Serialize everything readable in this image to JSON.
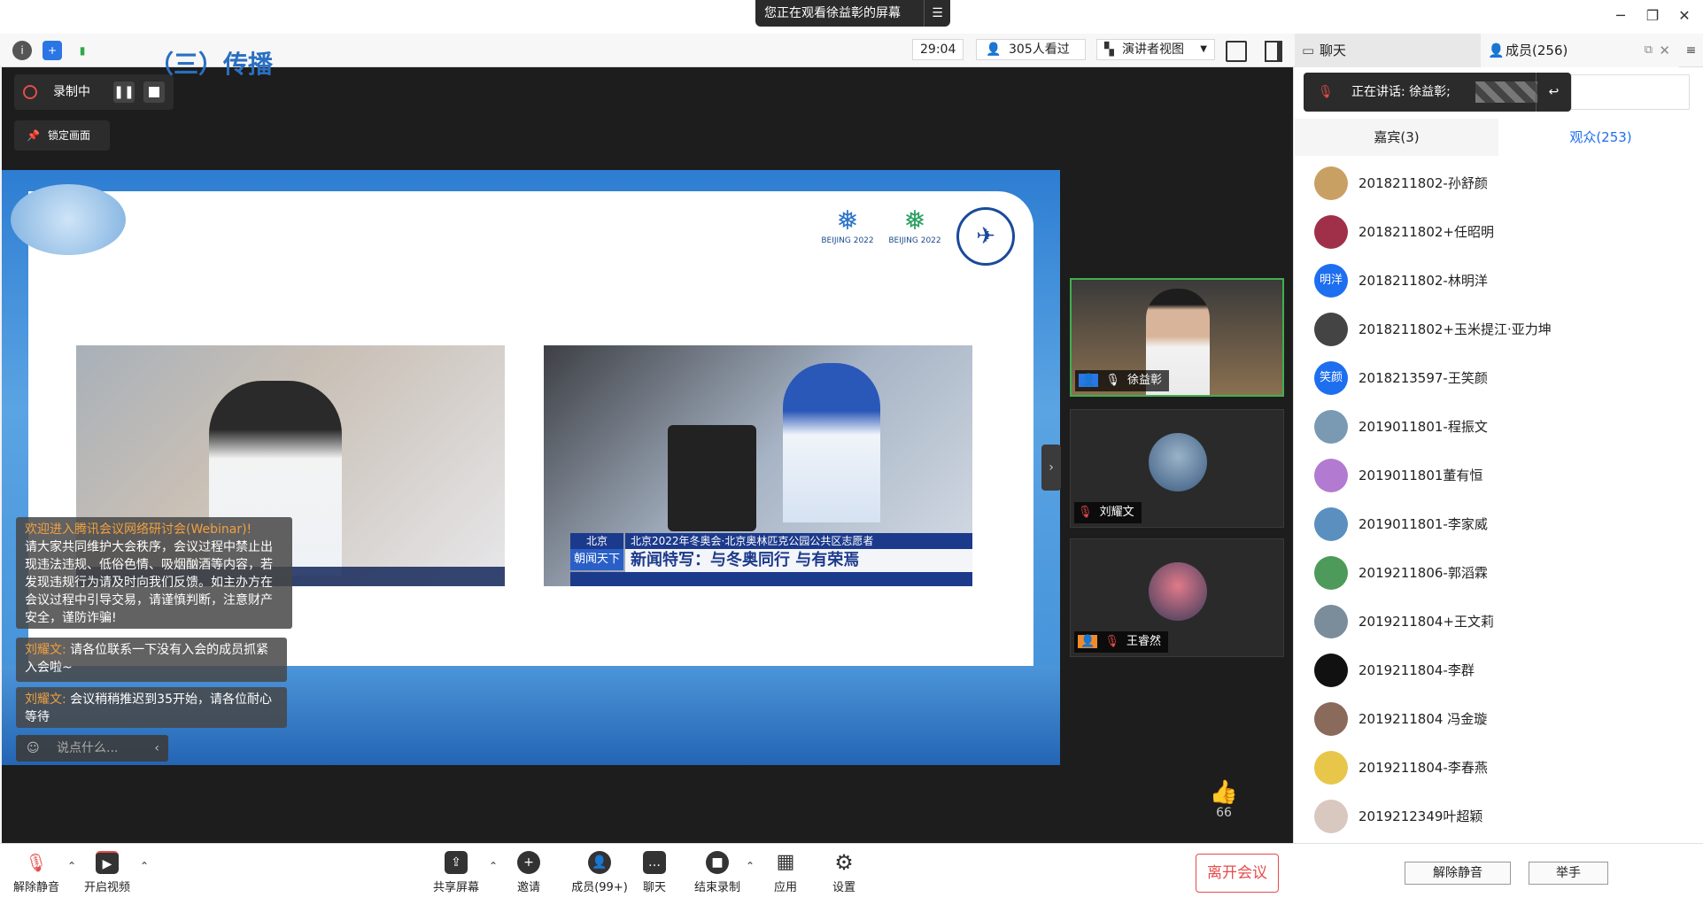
{
  "window": {
    "share_banner": "您正在观看徐益彰的屏幕"
  },
  "toolbar": {
    "timer": "29:04",
    "viewers": "305人看过",
    "view_mode": "演讲者视图",
    "chat_tab": "聊天",
    "members_tab": "成员(256)"
  },
  "recording": {
    "label": "录制中",
    "lock_label": "锁定画面"
  },
  "slide": {
    "title": "（三）传播",
    "logo1": "BEIJING 2022",
    "logo2": "BEIJING 2022",
    "video1_caption": "",
    "video2_location": "北京",
    "video2_program": "朝闻天下",
    "video2_banner": "北京2022年冬奥会·北京奥林匹克公园公共区志愿者",
    "video2_title": "新闻特写：与冬奥同行 与有荣焉"
  },
  "chat_overlay": {
    "system_title": "欢迎进入腾讯会议网络研讨会(Webinar)!",
    "system_body": "请大家共同维护大会秩序，会议过程中禁止出现违法违规、低俗色情、吸烟酗酒等内容，若发现违规行为请及时向我们反馈。如主办方在会议过程中引导交易，请谨慎判断，注意财产安全，谨防诈骗!",
    "msg1_name": "刘耀文:",
    "msg1_text": "请各位联系一下没有入会的成员抓紧入会啦~",
    "msg2_name": "刘耀文:",
    "msg2_text": "会议稍稍推迟到35开始，请各位耐心等待",
    "input_placeholder": "说点什么..."
  },
  "tiles": [
    {
      "name": "徐益彰"
    },
    {
      "name": "刘耀文"
    },
    {
      "name": "王睿然"
    }
  ],
  "likes": {
    "count": "66"
  },
  "side": {
    "speaking": "正在讲话: 徐益彰;",
    "tab_guests": "嘉宾(3)",
    "tab_audience": "观众(253)",
    "members": [
      {
        "name": "2018211802-孙舒颜",
        "avatar": "",
        "color": "#c9a063"
      },
      {
        "name": "2018211802+任昭明",
        "avatar": "",
        "color": "#a0304a"
      },
      {
        "name": "2018211802-林明洋",
        "avatar": "明洋",
        "color": "#1e6ef0"
      },
      {
        "name": "2018211802+玉米提江·亚力坤",
        "avatar": "",
        "color": "#444"
      },
      {
        "name": "2018213597-王笑颜",
        "avatar": "笑颜",
        "color": "#1e6ef0"
      },
      {
        "name": "2019011801-程振文",
        "avatar": "",
        "color": "#7a9ab3"
      },
      {
        "name": "2019011801董有恒",
        "avatar": "",
        "color": "#b27ad0"
      },
      {
        "name": "2019011801-李家威",
        "avatar": "",
        "color": "#5a8fc0"
      },
      {
        "name": "2019211806-郭滔霖",
        "avatar": "",
        "color": "#4d9a5a"
      },
      {
        "name": "2019211804+王文莉",
        "avatar": "",
        "color": "#7b8c9a"
      },
      {
        "name": "2019211804-李群",
        "avatar": "",
        "color": "#111"
      },
      {
        "name": "2019211804 冯金璇",
        "avatar": "",
        "color": "#8a6a5a"
      },
      {
        "name": "2019211804-李春燕",
        "avatar": "",
        "color": "#e8c64a"
      },
      {
        "name": "2019212349叶超颖",
        "avatar": "",
        "color": "#d8c8c0"
      }
    ],
    "unmute_btn": "解除静音",
    "raise_hand_btn": "举手"
  },
  "bottom": {
    "mute": "解除静音",
    "video": "开启视频",
    "share": "共享屏幕",
    "invite": "邀请",
    "members": "成员(99+)",
    "chat": "聊天",
    "end_record": "结束录制",
    "apps": "应用",
    "settings": "设置",
    "leave": "离开会议"
  }
}
